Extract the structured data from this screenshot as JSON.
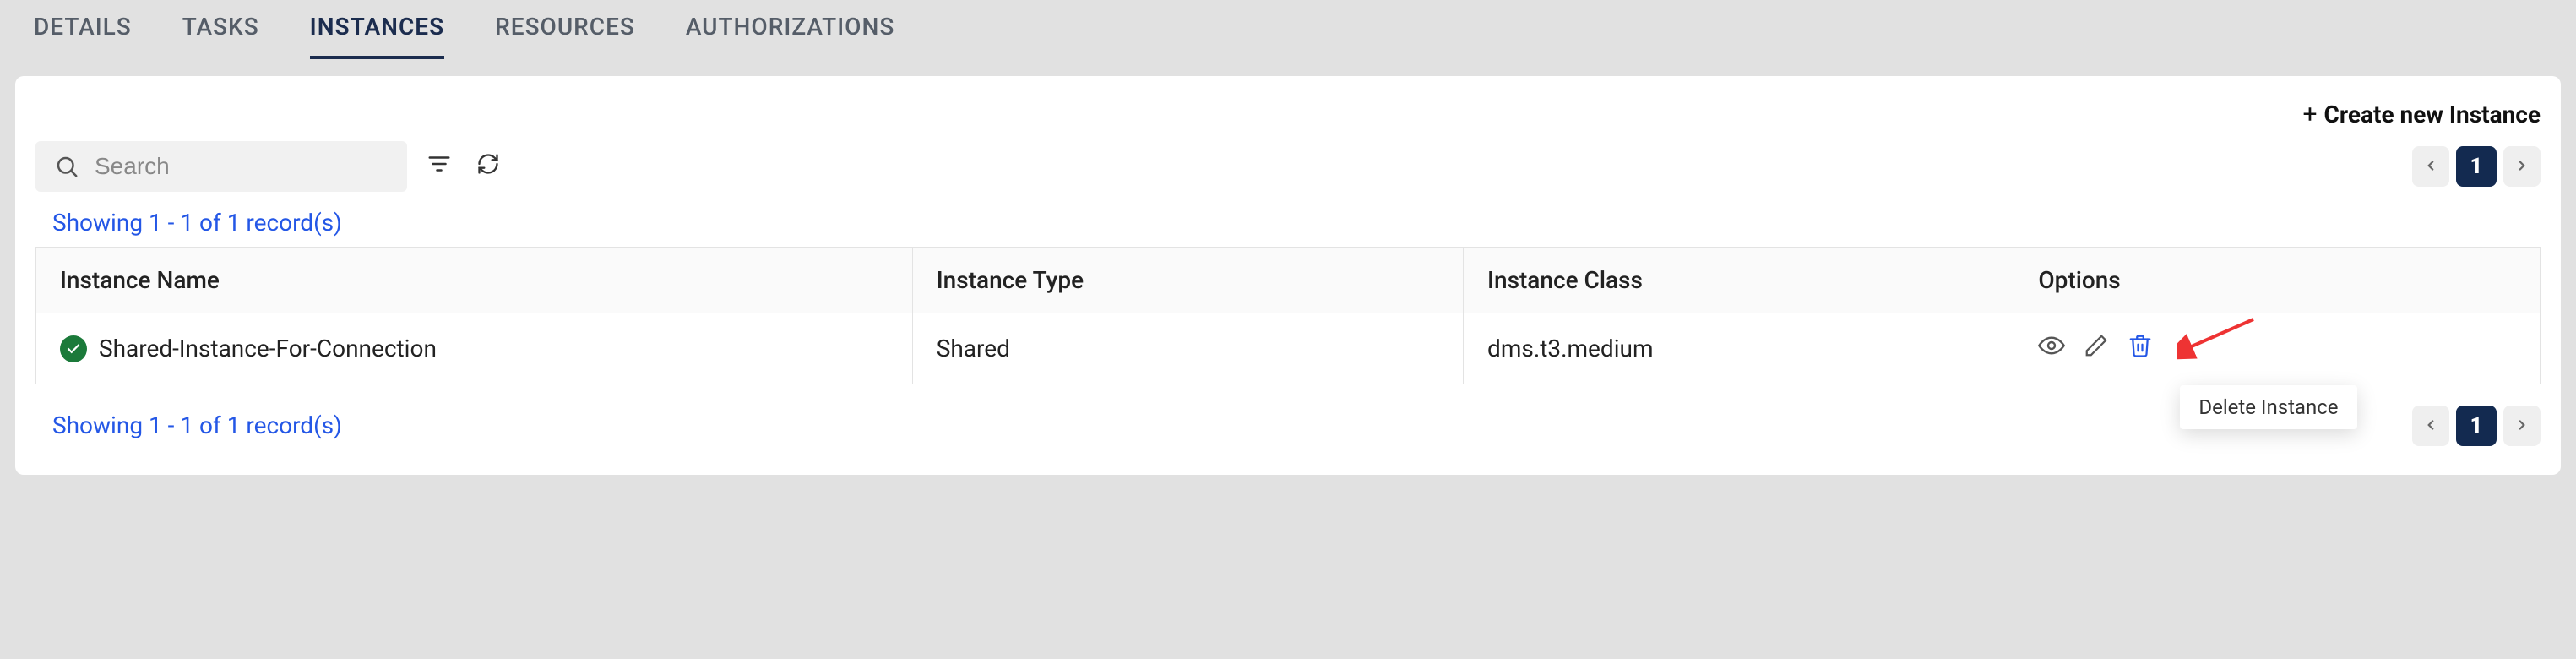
{
  "tabs": {
    "details": "DETAILS",
    "tasks": "TASKS",
    "instances": "INSTANCES",
    "resources": "RESOURCES",
    "authorizations": "AUTHORIZATIONS"
  },
  "create_button": "Create new Instance",
  "search": {
    "placeholder": "Search"
  },
  "pager": {
    "page": "1"
  },
  "records_text_top": "Showing 1 - 1 of 1 record(s)",
  "records_text_bottom": "Showing 1 - 1 of 1 record(s)",
  "table": {
    "headers": {
      "name": "Instance Name",
      "type": "Instance Type",
      "class": "Instance Class",
      "options": "Options"
    },
    "rows": [
      {
        "name": "Shared-Instance-For-Connection",
        "type": "Shared",
        "class": "dms.t3.medium"
      }
    ]
  },
  "tooltip": "Delete Instance"
}
